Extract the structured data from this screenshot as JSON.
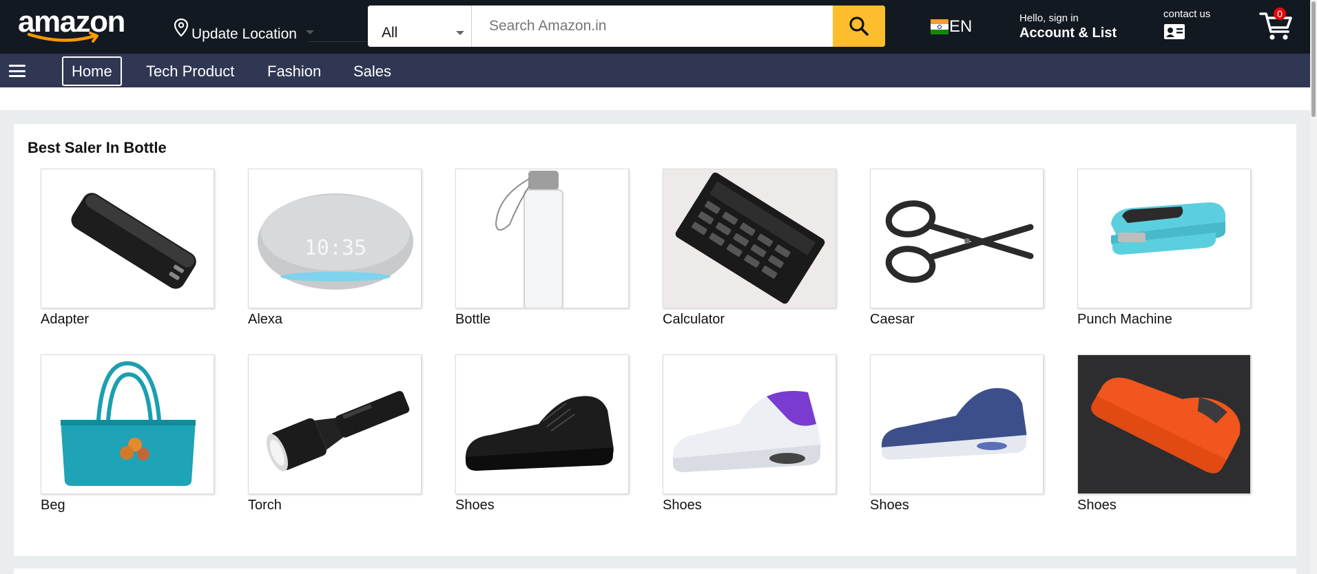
{
  "header": {
    "logo_text": "amazon",
    "location_label": "Update Location",
    "search": {
      "category": "All",
      "placeholder": "Search Amazon.in"
    },
    "language": "EN",
    "account": {
      "hello": "Hello, sign in",
      "main": "Account & List"
    },
    "contact_label": "contact us",
    "cart_count": "0"
  },
  "nav": {
    "items": [
      {
        "label": "Home",
        "active": true
      },
      {
        "label": "Tech Product"
      },
      {
        "label": "Fashion"
      },
      {
        "label": "Sales"
      }
    ]
  },
  "section": {
    "title": "Best Saler In Bottle",
    "products": [
      {
        "name": "Adapter",
        "icon": "power-bank-image"
      },
      {
        "name": "Alexa",
        "icon": "smart-speaker-image"
      },
      {
        "name": "Bottle",
        "icon": "water-bottle-image"
      },
      {
        "name": "Calculator",
        "icon": "calculator-image"
      },
      {
        "name": "Caesar",
        "icon": "scissors-image"
      },
      {
        "name": "Punch Machine",
        "icon": "stapler-image"
      },
      {
        "name": "Beg",
        "icon": "handbag-image"
      },
      {
        "name": "Torch",
        "icon": "flashlight-image"
      },
      {
        "name": "Shoes",
        "icon": "black-sneaker-image"
      },
      {
        "name": "Shoes",
        "icon": "white-purple-sneaker-image"
      },
      {
        "name": "Shoes",
        "icon": "blue-sneaker-image"
      },
      {
        "name": "Shoes",
        "icon": "orange-running-shoe-image"
      }
    ]
  },
  "colors": {
    "header_bg": "#131921",
    "nav_bg": "#2f3753",
    "search_button": "#febd2c",
    "page_bg": "#eaeded",
    "cart_badge": "#e10b0b"
  }
}
